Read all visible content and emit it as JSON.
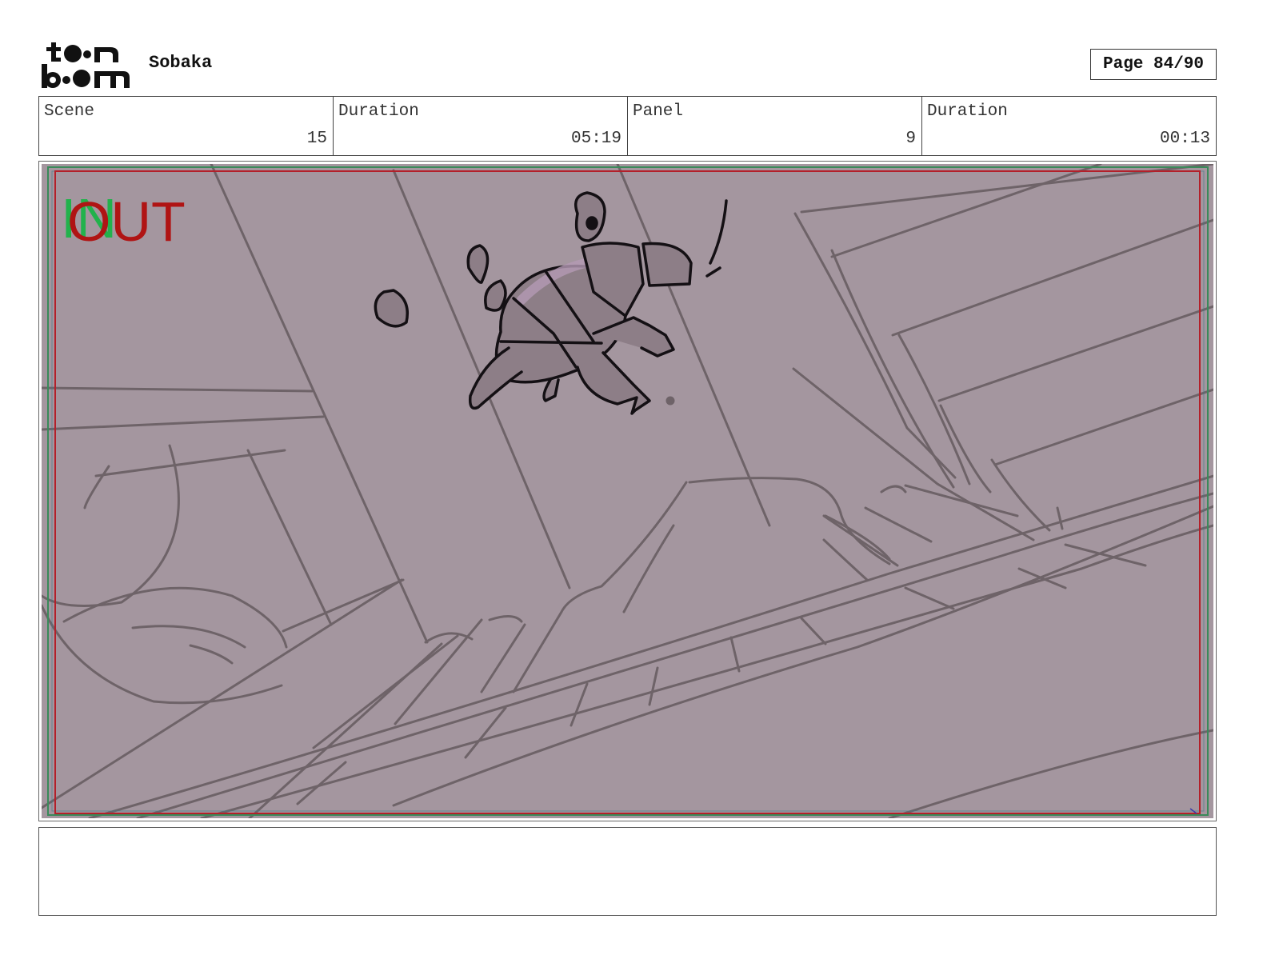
{
  "header": {
    "logo_text": "toon boom",
    "project_title": "Sobaka",
    "page_label": "Page 84/90"
  },
  "info": {
    "scene_label": "Scene",
    "scene_value": "15",
    "scene_duration_label": "Duration",
    "scene_duration_value": "05:19",
    "panel_label": "Panel",
    "panel_value": "9",
    "panel_duration_label": "Duration",
    "panel_duration_value": "00:13"
  },
  "panel": {
    "in_marker": "IN",
    "out_marker": "OUT",
    "colors": {
      "background": "#a4969f",
      "sketch_line": "#6e6368",
      "character_fill": "#8d7e87",
      "character_highlight": "#b49ab4",
      "character_line": "#141014",
      "safe_area_red": "#b3202a",
      "frame_green": "#3a8a5a",
      "in_green": "#22b24c",
      "out_red": "#b01414"
    }
  },
  "notes": {
    "text": ""
  }
}
